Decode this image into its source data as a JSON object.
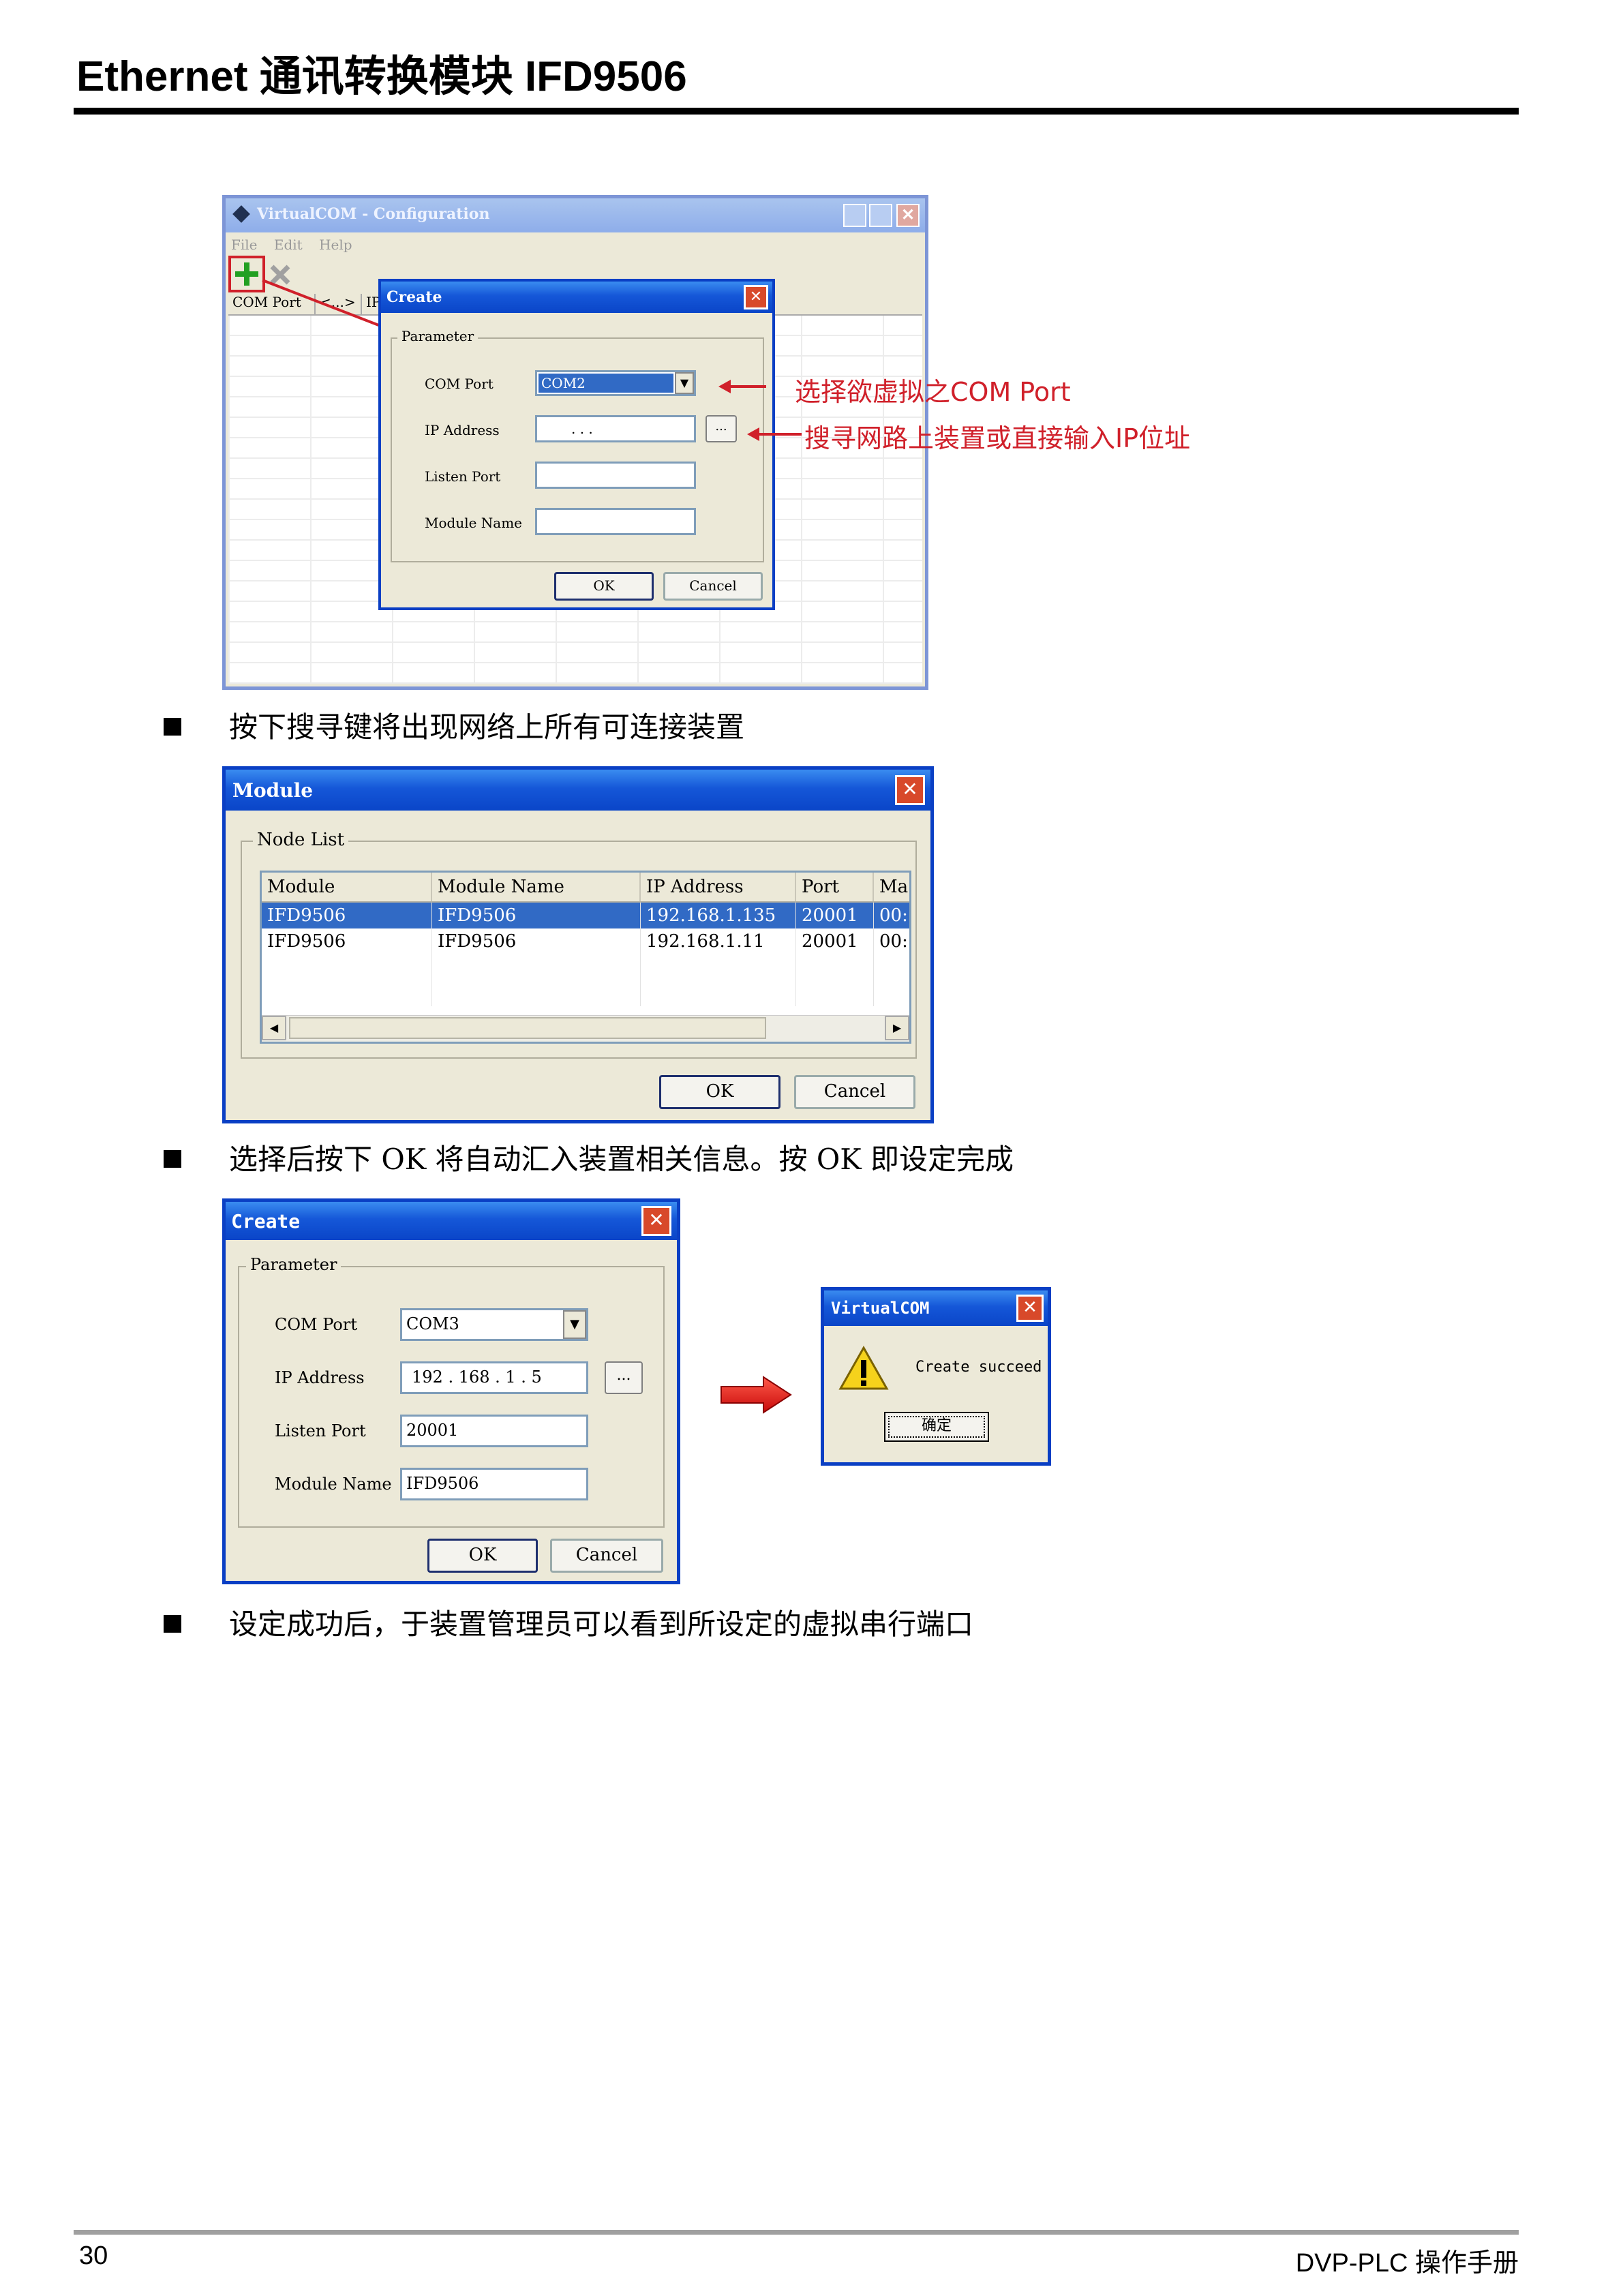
{
  "header": {
    "title": "Ethernet 通讯转换模块  IFD9506"
  },
  "footer": {
    "page_number": "30",
    "manual": "DVP-PLC  操作手册"
  },
  "bullets": [
    "按下搜寻键将出现网络上所有可连接装置",
    "选择后按下 OK 将自动汇入装置相关信息。按 OK 即设定完成",
    "设定成功后，于装置管理员可以看到所设定的虚拟串行端口"
  ],
  "screenshot1": {
    "main_title": "VirtualCOM - Configuration",
    "menu": [
      "File",
      "Edit",
      "Help"
    ],
    "columns": [
      "COM Port",
      "<...>",
      "IP"
    ],
    "dialog": {
      "title": "Create",
      "group": "Parameter",
      "com_port_label": "COM Port",
      "com_port_value": "COM2",
      "ip_label": "IP Address",
      "ip_value": ".    .    .",
      "listen_port_label": "Listen Port",
      "module_name_label": "Module Name",
      "browse": "...",
      "ok": "OK",
      "cancel": "Cancel"
    },
    "annotation_com": "选择欲虚拟之COM Port",
    "annotation_ip": "搜寻网路上装置或直接输入IP位址",
    "accent": "#d0202a"
  },
  "module_dialog": {
    "title": "Module",
    "group": "Node List",
    "columns": [
      "Module",
      "Module Name",
      "IP Address",
      "Port",
      "Ma"
    ],
    "rows": [
      [
        "IFD9506",
        "IFD9506",
        "192.168.1.135",
        "20001",
        "00:"
      ],
      [
        "IFD9506",
        "IFD9506",
        "192.168.1.11",
        "20001",
        "00:"
      ]
    ],
    "ok": "OK",
    "cancel": "Cancel"
  },
  "create_dialog": {
    "title": "Create",
    "group": "Parameter",
    "com_port_label": "COM Port",
    "com_port_value": "COM3",
    "ip_label": "IP Address",
    "ip_value": "192 . 168 .  1  .  5",
    "listen_port_label": "Listen Port",
    "listen_port_value": "20001",
    "module_name_label": "Module Name",
    "module_name_value": "IFD9506",
    "browse": "...",
    "ok": "OK",
    "cancel": "Cancel"
  },
  "message_box": {
    "title": "VirtualCOM",
    "message": "Create succeed",
    "button": "确定"
  },
  "icons": [
    "add-icon",
    "delete-icon",
    "warning-icon",
    "arrow-right-icon"
  ]
}
